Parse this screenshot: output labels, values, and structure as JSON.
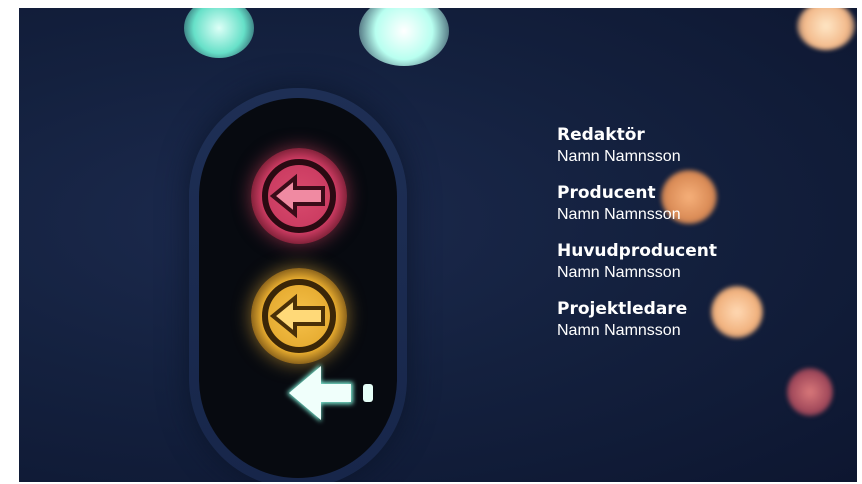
{
  "credits": [
    {
      "role": "Redaktör",
      "name": "Namn Namnsson"
    },
    {
      "role": "Producent",
      "name": "Namn Namnsson"
    },
    {
      "role": "Huvudproducent",
      "name": "Namn Namnsson"
    },
    {
      "role": "Projektledare",
      "name": "Namn Namnsson"
    }
  ],
  "background": {
    "subject": "traffic-light-with-left-arrows",
    "colors": {
      "sky": "#14213f",
      "red_lamp": "#c93a60",
      "amber_lamp": "#e4a92e",
      "green_arrow": "#d8fff4",
      "bokeh": "#f4b27a"
    }
  }
}
